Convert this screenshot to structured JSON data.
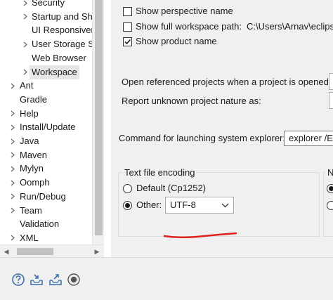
{
  "tree": {
    "items": [
      {
        "label": "Security",
        "arrow": true
      },
      {
        "label": "Startup and Shutdown",
        "arrow": true
      },
      {
        "label": "UI Responsiveness Monitoring",
        "arrow": false
      },
      {
        "label": "User Storage Service",
        "arrow": true
      },
      {
        "label": "Web Browser",
        "arrow": false
      },
      {
        "label": "Workspace",
        "arrow": true,
        "selected": true
      },
      {
        "label": "Ant",
        "arrow": true
      },
      {
        "label": "Gradle",
        "arrow": false
      },
      {
        "label": "Help",
        "arrow": true
      },
      {
        "label": "Install/Update",
        "arrow": true
      },
      {
        "label": "Java",
        "arrow": true
      },
      {
        "label": "Maven",
        "arrow": true
      },
      {
        "label": "Mylyn",
        "arrow": true
      },
      {
        "label": "Oomph",
        "arrow": true
      },
      {
        "label": "Run/Debug",
        "arrow": true
      },
      {
        "label": "Team",
        "arrow": true
      },
      {
        "label": "Validation",
        "arrow": false
      },
      {
        "label": "XML",
        "arrow": true
      }
    ]
  },
  "prefs": {
    "show_perspective_name": {
      "label": "Show perspective name",
      "checked": false
    },
    "show_full_workspace_path": {
      "label": "Show full workspace path:",
      "checked": false,
      "value": "C:\\Users\\Arnav\\eclipse-workspace"
    },
    "show_product_name": {
      "label": "Show product name",
      "checked": true
    },
    "open_referenced_label": "Open referenced projects when a project is opened:",
    "report_unknown_label": "Report unknown project nature as:",
    "command_label": "Command for launching system explorer:",
    "command_value": "explorer /E,/select=${selected_resource_loc}",
    "encoding": {
      "group_label": "Text file encoding",
      "default_option": "Default (Cp1252)",
      "other_option": "Other:",
      "other_value": "UTF-8",
      "selected": "other"
    },
    "second_group_label": "N"
  },
  "colors": {
    "annotation": "#e0201c"
  }
}
